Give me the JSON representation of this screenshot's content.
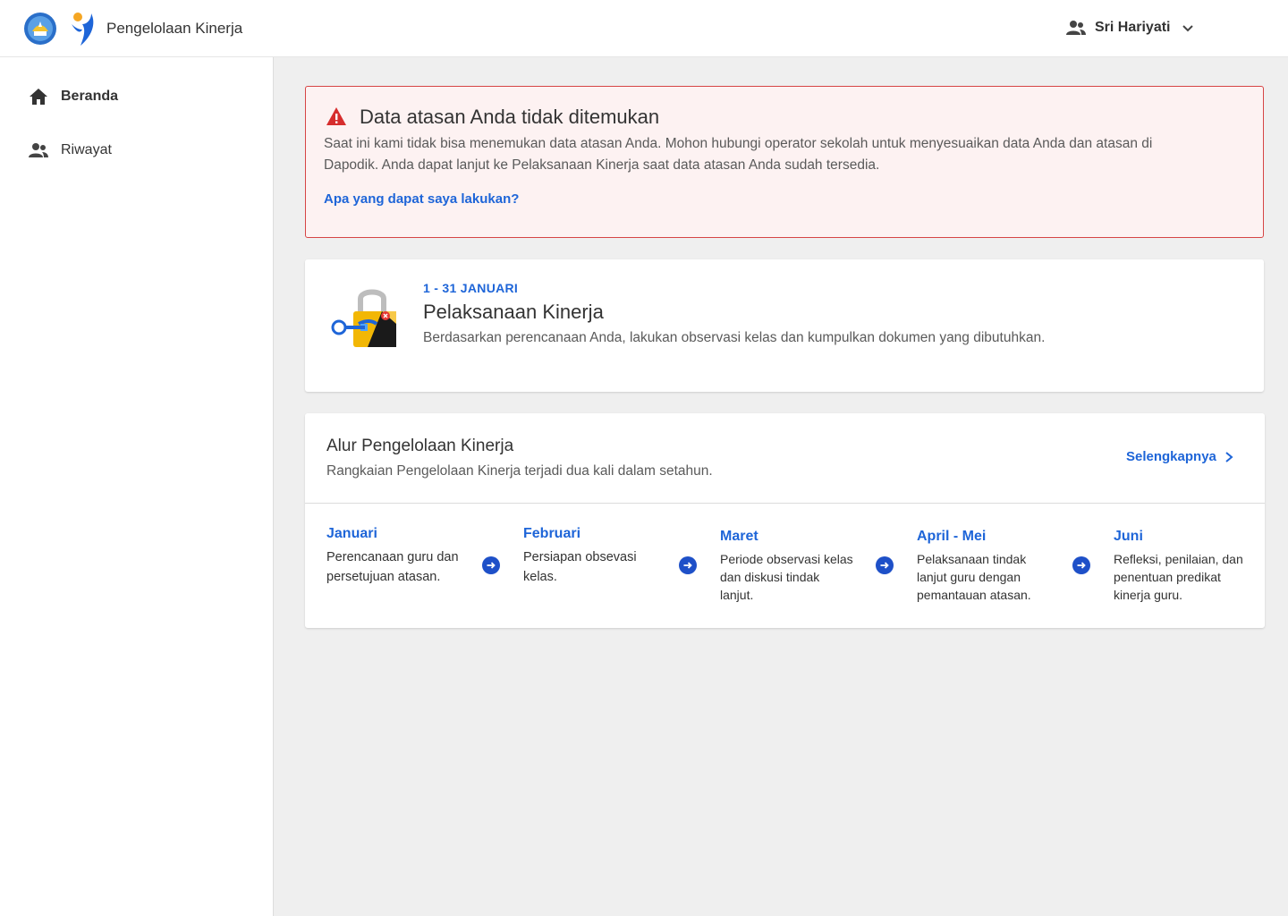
{
  "header": {
    "app_title": "Pengelolaan Kinerja",
    "user_name": "Sri Hariyati",
    "icons": {
      "logo": "kemdikbud-logo-icon",
      "app_logo": "app-logo-icon",
      "user": "user-group-icon",
      "dropdown": "chevron-down-icon"
    }
  },
  "sidebar": {
    "items": [
      {
        "label": "Beranda",
        "icon": "home-icon",
        "active": true
      },
      {
        "label": "Riwayat",
        "icon": "people-icon",
        "active": false
      }
    ]
  },
  "alert": {
    "title": "Data atasan Anda tidak ditemukan",
    "text": "Saat ini kami tidak bisa menemukan data atasan Anda. Mohon hubungi operator sekolah untuk menyesuaikan data Anda dan atasan di Dapodik. Anda dapat lanjut ke Pelaksanaan Kinerja saat data atasan Anda sudah tersedia.",
    "link": "Apa yang dapat saya lakukan?",
    "icon": "warning-icon"
  },
  "execution": {
    "date": "1 - 31 JANUARI",
    "title": "Pelaksanaan Kinerja",
    "description": "Berdasarkan perencanaan Anda, lakukan observasi kelas dan kumpulkan dokumen yang dibutuhkan.",
    "icon": "lock-icon"
  },
  "flow": {
    "title": "Alur Pengelolaan Kinerja",
    "subtitle": "Rangkaian Pengelolaan Kinerja terjadi dua kali dalam setahun.",
    "more": "Selengkapnya",
    "steps": [
      {
        "month": "Januari",
        "desc": "Perencanaan guru dan persetujuan atasan."
      },
      {
        "month": "Februari",
        "desc": "Persiapan obsevasi kelas."
      },
      {
        "month": "Maret",
        "desc": "Periode observasi kelas dan diskusi tindak lanjut."
      },
      {
        "month": "April - Mei",
        "desc": "Pelaksanaan tindak lanjut guru dengan pemantauan atasan."
      },
      {
        "month": "Juni",
        "desc": "Refleksi, penilaian, dan penentuan predikat kinerja guru."
      }
    ]
  },
  "colors": {
    "primary": "#1e65d8",
    "danger": "#d64545",
    "alert_bg": "#fdf2f2",
    "page_bg": "#efefef"
  }
}
